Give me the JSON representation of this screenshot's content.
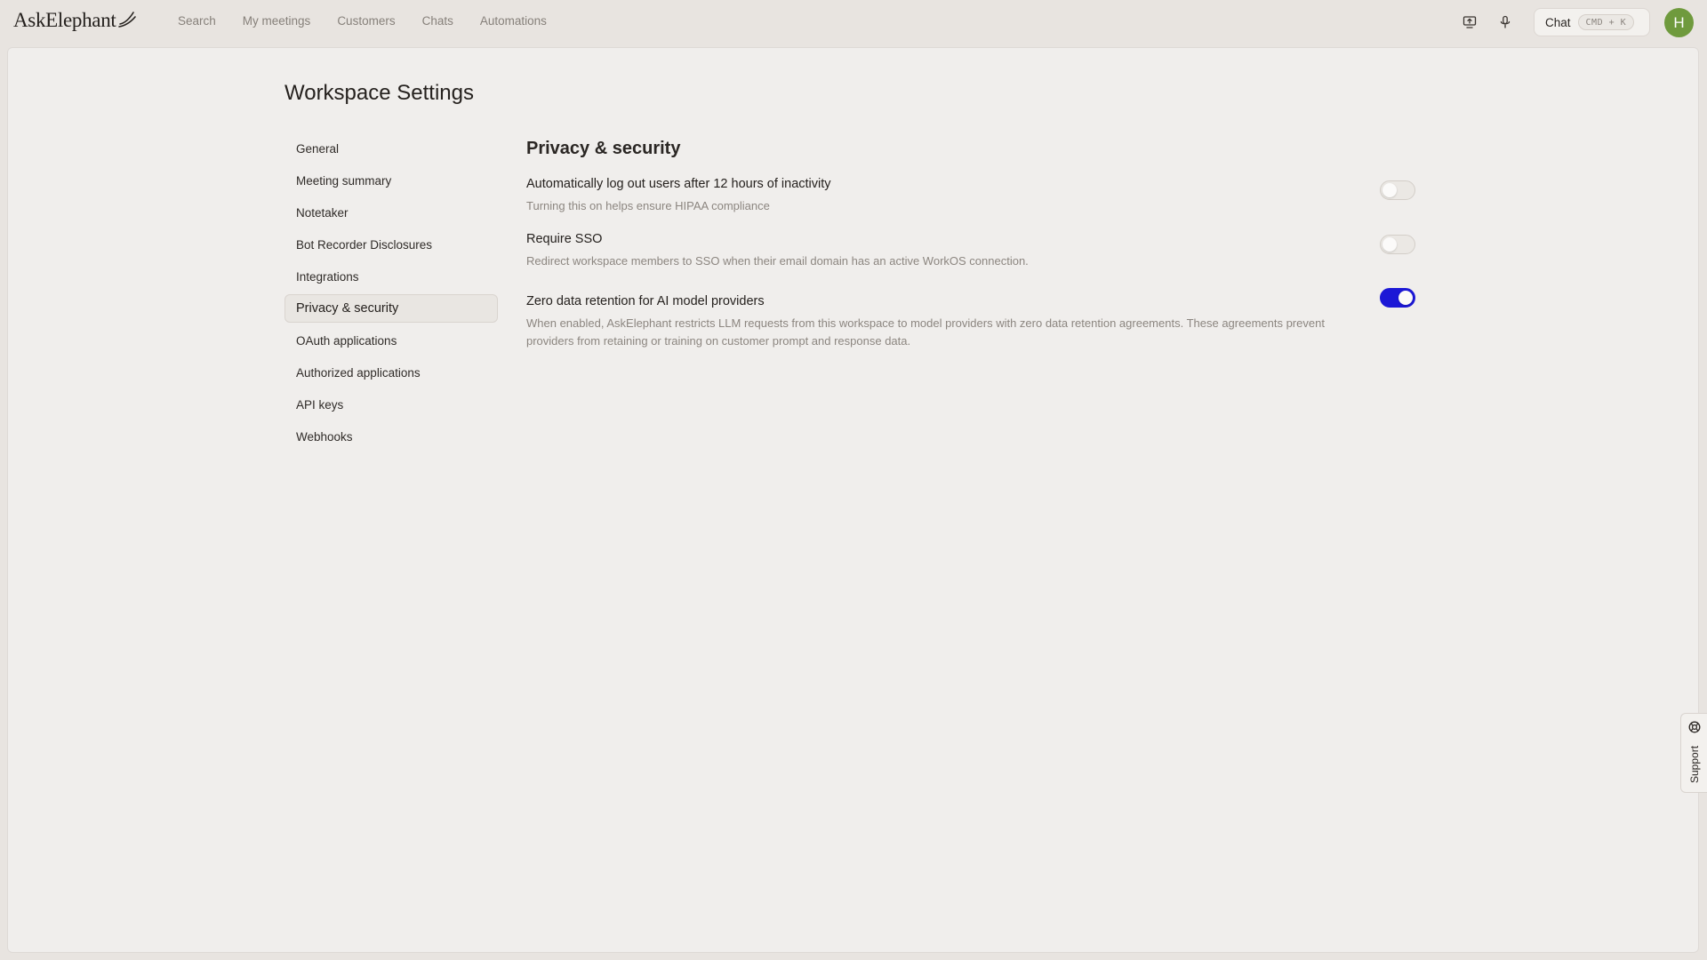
{
  "app": {
    "logo_text": "AskElephant"
  },
  "nav": {
    "items": [
      "Search",
      "My meetings",
      "Customers",
      "Chats",
      "Automations"
    ]
  },
  "topbar": {
    "screen_icon": "screen-share-icon",
    "mic_icon": "microphone-icon",
    "chat_label": "Chat",
    "chat_shortcut": "CMD + K",
    "avatar_initial": "H",
    "avatar_color": "#6f9a3d"
  },
  "page": {
    "title": "Workspace Settings"
  },
  "sidebar": {
    "items": [
      {
        "label": "General"
      },
      {
        "label": "Meeting summary"
      },
      {
        "label": "Notetaker"
      },
      {
        "label": "Bot Recorder Disclosures"
      },
      {
        "label": "Integrations"
      },
      {
        "label": "Privacy & security",
        "active": true
      },
      {
        "label": "OAuth applications"
      },
      {
        "label": "Authorized applications"
      },
      {
        "label": "API keys"
      },
      {
        "label": "Webhooks"
      }
    ]
  },
  "section": {
    "title": "Privacy & security",
    "settings": [
      {
        "title": "Automatically log out users after 12 hours of inactivity",
        "description": "Turning this on helps ensure HIPAA compliance",
        "enabled": false
      },
      {
        "title": "Require SSO",
        "description": "Redirect workspace members to SSO when their email domain has an active WorkOS connection.",
        "enabled": false
      },
      {
        "title": "Zero data retention for AI model providers",
        "description": "When enabled, AskElephant restricts LLM requests from this workspace to model providers with zero data retention agreements. These agreements prevent providers from retaining or training on customer prompt and response data.",
        "enabled": true
      }
    ]
  },
  "colors": {
    "toggle_on": "#1c18d6"
  },
  "support": {
    "label": "Support",
    "icon": "lifebuoy-icon"
  }
}
